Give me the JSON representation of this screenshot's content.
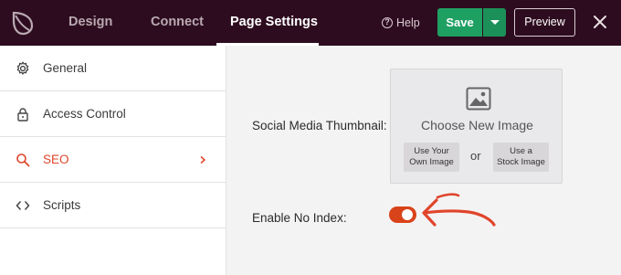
{
  "header": {
    "tabs": [
      {
        "label": "Design"
      },
      {
        "label": "Connect"
      },
      {
        "label": "Page Settings"
      }
    ],
    "help_label": "Help",
    "save_label": "Save",
    "preview_label": "Preview"
  },
  "sidebar": {
    "items": [
      {
        "label": "General",
        "icon": "gear-icon"
      },
      {
        "label": "Access Control",
        "icon": "lock-icon"
      },
      {
        "label": "SEO",
        "icon": "search-icon",
        "active": true
      },
      {
        "label": "Scripts",
        "icon": "code-icon"
      }
    ]
  },
  "main": {
    "thumbnail_label": "Social Media Thumbnail:",
    "choose_image": "Choose New Image",
    "own_image_line1": "Use Your",
    "own_image_line2": "Own Image",
    "or": "or",
    "stock_image_line1": "Use a",
    "stock_image_line2": "Stock Image",
    "no_index_label": "Enable No Index:",
    "no_index_enabled": true
  },
  "colors": {
    "topbar": "#2e0c1f",
    "save": "#1fa063",
    "accent": "#e0452c",
    "toggle": "#d9431a",
    "annotation_arrow": "#e0452c"
  }
}
